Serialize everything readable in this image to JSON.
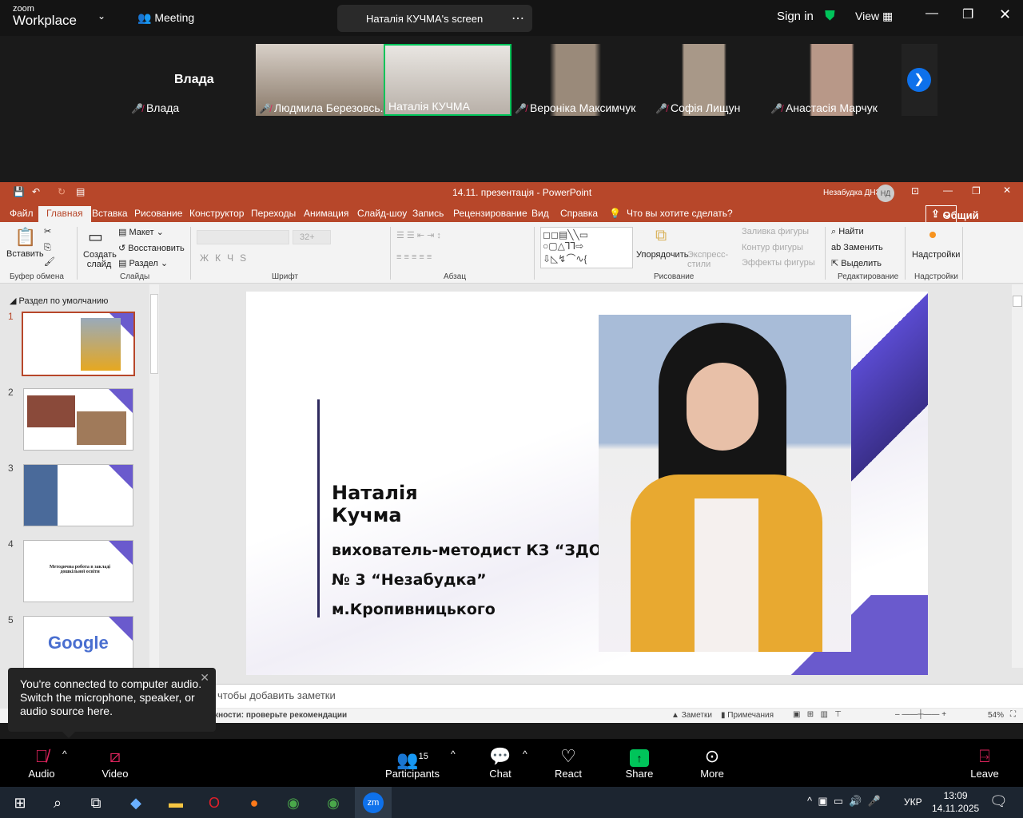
{
  "zoom": {
    "logo_top": "zoom",
    "logo_bottom": "Workplace",
    "meeting_label": "Meeting",
    "share_title": "Наталія КУЧМА's screen",
    "sign_in": "Sign in",
    "view": "View",
    "participants": [
      {
        "name": "Влада",
        "big_name": "Влада",
        "muted": true
      },
      {
        "name": "Людмила Березовсь...",
        "muted": true
      },
      {
        "name": "Наталія КУЧМА",
        "muted": false,
        "active": true
      },
      {
        "name": "Вероніка Максимчук",
        "muted": true
      },
      {
        "name": "Софія Лищун",
        "muted": true
      },
      {
        "name": "Анастасія Марчук",
        "muted": true
      }
    ],
    "tooltip": "You're connected to computer audio. Switch the microphone, speaker, or audio source here.",
    "toolbar": {
      "audio": "Audio",
      "video": "Video",
      "participants": "Participants",
      "participants_count": "15",
      "chat": "Chat",
      "react": "React",
      "share": "Share",
      "more": "More",
      "leave": "Leave"
    },
    "accent": "#00c45a"
  },
  "ppt": {
    "title": "14.11. презентація  -  PowerPoint",
    "user": "Незабудка ДНЗ",
    "user_initials": "НД",
    "tabs": [
      "Файл",
      "Главная",
      "Вставка",
      "Рисование",
      "Конструктор",
      "Переходы",
      "Анимация",
      "Слайд-шоу",
      "Запись",
      "Рецензирование",
      "Вид",
      "Справка"
    ],
    "search": "Что вы хотите сделать?",
    "share": "Общий доступ",
    "ribbon": {
      "paste": "Вставить",
      "clipboard": "Буфер обмена",
      "new_slide": "Создать слайд",
      "layout": "Макет",
      "reset": "Восстановить",
      "section": "Раздел",
      "slides": "Слайды",
      "font_size": "32+",
      "font": "Шрифт",
      "paragraph": "Абзац",
      "arrange": "Упорядочить",
      "quick_styles": "Экспресс-стили",
      "fill": "Заливка фигуры",
      "outline": "Контур фигуры",
      "effects": "Эффекты фигуры",
      "drawing": "Рисование",
      "find": "Найти",
      "replace": "Заменить",
      "select": "Выделить",
      "editing": "Редактирование",
      "addins": "Надстройки",
      "addins_group": "Надстройки"
    },
    "section_label": "Раздел по умолчанию",
    "thumb_numbers": [
      "1",
      "2",
      "3",
      "4",
      "5"
    ],
    "thumb4_text": "Методична робота в закладі дошкільної освіти",
    "thumb5_text": "Google",
    "slide": {
      "name_line1": "Наталія",
      "name_line2": "Кучма",
      "line3": "вихователь-методист КЗ “ЗДО",
      "line4": "№ 3 “Незабудка”",
      "line5": "м.Кропивницького"
    },
    "notes_placeholder": "чтобы добавить заметки",
    "status": {
      "accessibility": "жности: проверьте рекомендации",
      "notes": "Заметки",
      "comments": "Примечания",
      "zoom": "54%"
    },
    "accent": "#b7472a"
  },
  "taskbar": {
    "lang": "УКР",
    "time": "13:09",
    "date": "14.11.2025"
  }
}
